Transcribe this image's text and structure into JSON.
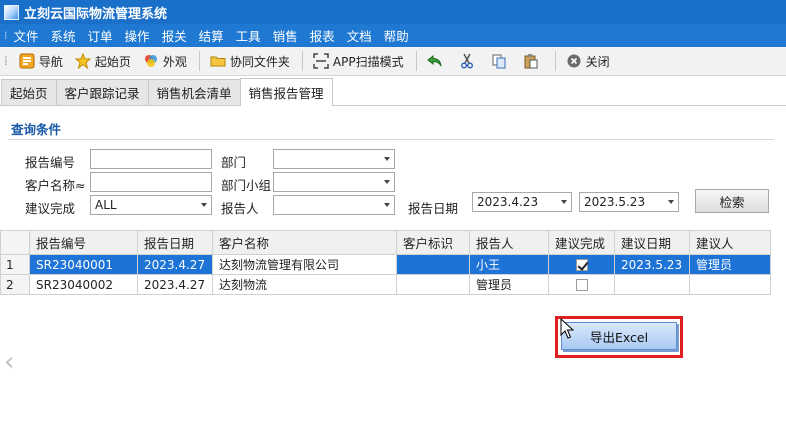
{
  "window": {
    "title": "立刻云国际物流管理系统"
  },
  "menu": [
    "文件",
    "系统",
    "订单",
    "操作",
    "报关",
    "结算",
    "工具",
    "销售",
    "报表",
    "文档",
    "帮助"
  ],
  "toolbar": {
    "nav": "导航",
    "home": "起始页",
    "appearance": "外观",
    "shared_folder": "协同文件夹",
    "app_scan": "APP扫描模式",
    "close": "关闭"
  },
  "tabs": [
    "起始页",
    "客户跟踪记录",
    "销售机会清单",
    "销售报告管理"
  ],
  "query": {
    "title": "查询条件",
    "report_no_label": "报告编号",
    "customer_name_label": "客户名称≈",
    "suggest_done_label": "建议完成",
    "suggest_done_value": "ALL",
    "dept_label": "部门",
    "dept_group_label": "部门小组",
    "reporter_label": "报告人",
    "report_date_label": "报告日期",
    "date_from": "2023.4.23",
    "date_to": "2023.5.23",
    "search_button": "检索"
  },
  "grid": {
    "columns": [
      "报告编号",
      "报告日期",
      "客户名称",
      "客户标识",
      "报告人",
      "建议完成",
      "建议日期",
      "建议人"
    ],
    "rows": [
      {
        "index": "1",
        "report_no": "SR23040001",
        "report_date": "2023.4.27",
        "customer": "达刻物流管理有限公司",
        "customer_tag": "",
        "reporter": "小王",
        "done": true,
        "suggest_date": "2023.5.23",
        "suggester": "管理员"
      },
      {
        "index": "2",
        "report_no": "SR23040002",
        "report_date": "2023.4.27",
        "customer": "达刻物流",
        "customer_tag": "",
        "reporter": "管理员",
        "done": false,
        "suggest_date": "",
        "suggester": ""
      }
    ]
  },
  "actions": {
    "export_excel": "导出Excel"
  },
  "colors": {
    "title_bar": "#1a6fc9",
    "selection": "#1d73d6",
    "highlight": "#e02020"
  }
}
